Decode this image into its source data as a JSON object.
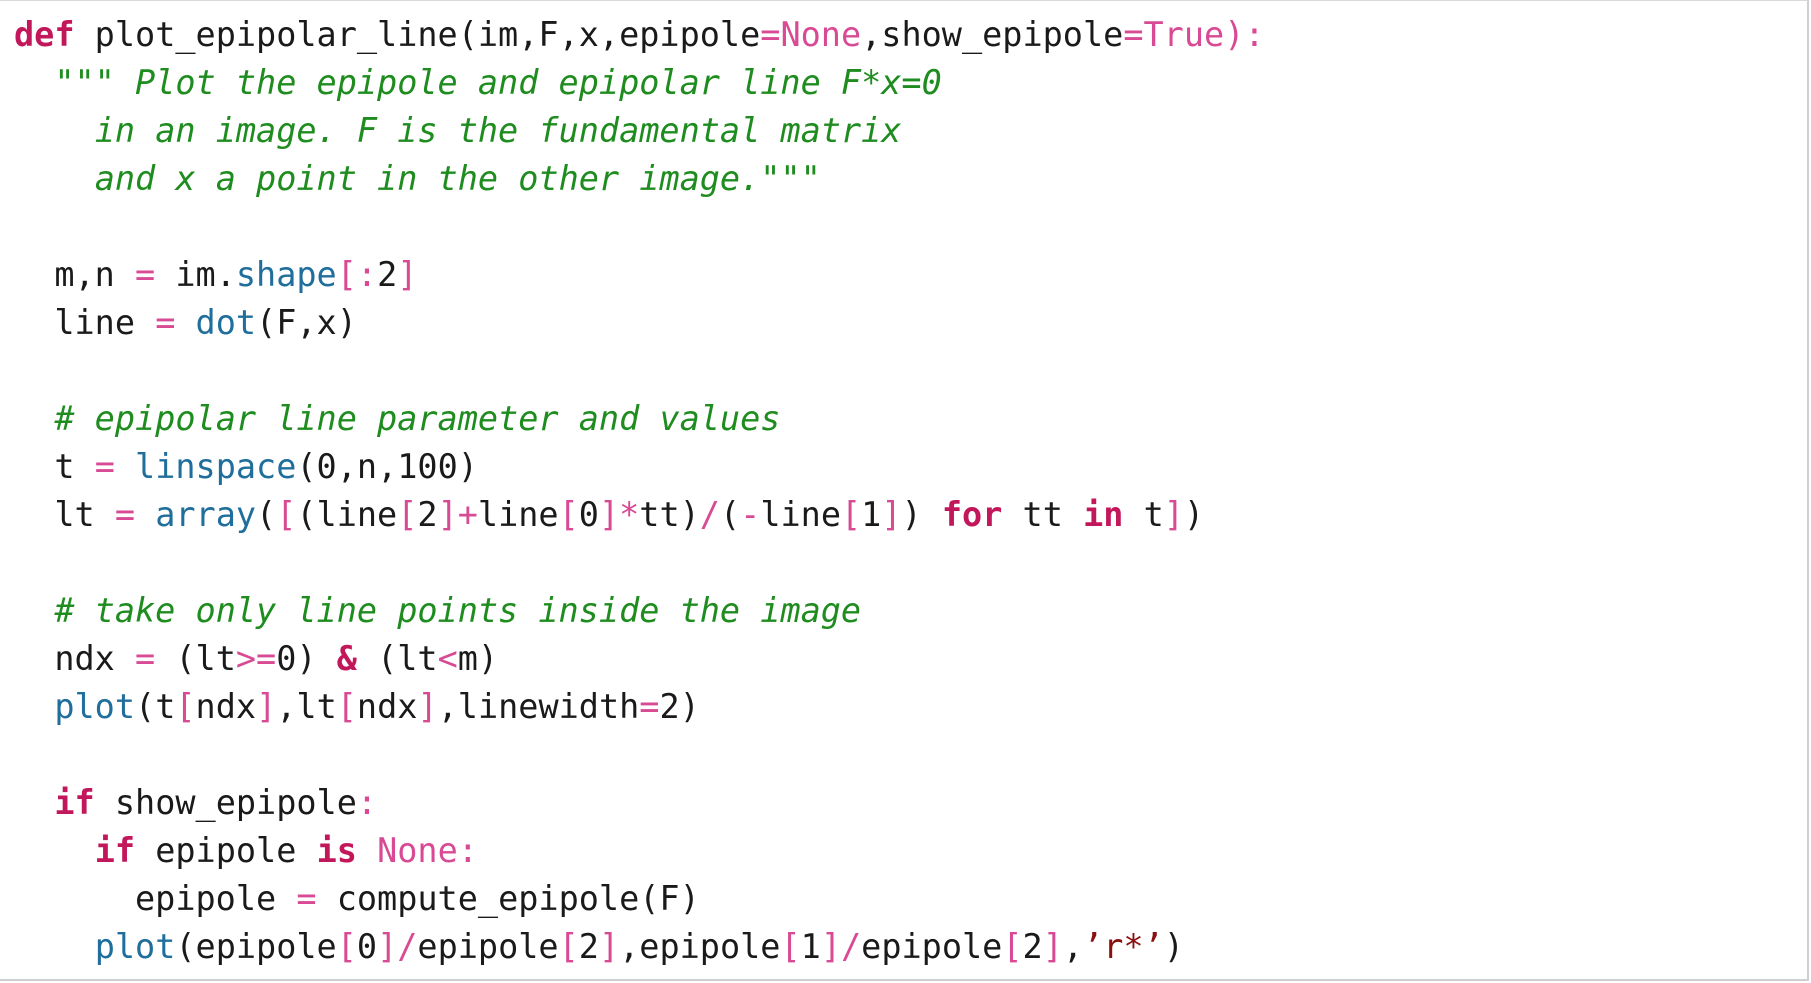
{
  "code": {
    "lines": [
      [
        {
          "t": "def",
          "c": "k"
        },
        {
          "t": " plot_epipolar_line(im,F,x,epipole",
          "c": "t"
        },
        {
          "t": "=",
          "c": "o"
        },
        {
          "t": "None",
          "c": "b"
        },
        {
          "t": ",show_epipole",
          "c": "t"
        },
        {
          "t": "=",
          "c": "o"
        },
        {
          "t": "True",
          "c": "b"
        },
        {
          "t": "):",
          "c": "o"
        }
      ],
      [
        {
          "t": "  ",
          "c": "t"
        },
        {
          "t": "\"\"\" Plot the epipole and epipolar line F*x=0",
          "c": "c"
        }
      ],
      [
        {
          "t": "    ",
          "c": "t"
        },
        {
          "t": "in an image. F is the fundamental matrix",
          "c": "c"
        }
      ],
      [
        {
          "t": "    ",
          "c": "t"
        },
        {
          "t": "and x a point in the other image.\"\"\"",
          "c": "c"
        }
      ],
      [],
      [
        {
          "t": "  m,n ",
          "c": "t"
        },
        {
          "t": "=",
          "c": "o"
        },
        {
          "t": " im.",
          "c": "t"
        },
        {
          "t": "shape",
          "c": "f"
        },
        {
          "t": "[:",
          "c": "o"
        },
        {
          "t": "2",
          "c": "t"
        },
        {
          "t": "]",
          "c": "o"
        }
      ],
      [
        {
          "t": "  line ",
          "c": "t"
        },
        {
          "t": "=",
          "c": "o"
        },
        {
          "t": " ",
          "c": "t"
        },
        {
          "t": "dot",
          "c": "f"
        },
        {
          "t": "(F,x)",
          "c": "t"
        }
      ],
      [],
      [
        {
          "t": "  ",
          "c": "t"
        },
        {
          "t": "# epipolar line parameter and values",
          "c": "c"
        }
      ],
      [
        {
          "t": "  t ",
          "c": "t"
        },
        {
          "t": "=",
          "c": "o"
        },
        {
          "t": " ",
          "c": "t"
        },
        {
          "t": "linspace",
          "c": "f"
        },
        {
          "t": "(0,n,100)",
          "c": "t"
        }
      ],
      [
        {
          "t": "  lt ",
          "c": "t"
        },
        {
          "t": "=",
          "c": "o"
        },
        {
          "t": " ",
          "c": "t"
        },
        {
          "t": "array",
          "c": "f"
        },
        {
          "t": "(",
          "c": "t"
        },
        {
          "t": "[",
          "c": "o"
        },
        {
          "t": "(line",
          "c": "t"
        },
        {
          "t": "[",
          "c": "o"
        },
        {
          "t": "2",
          "c": "t"
        },
        {
          "t": "]+",
          "c": "o"
        },
        {
          "t": "line",
          "c": "t"
        },
        {
          "t": "[",
          "c": "o"
        },
        {
          "t": "0",
          "c": "t"
        },
        {
          "t": "]*",
          "c": "o"
        },
        {
          "t": "tt)",
          "c": "t"
        },
        {
          "t": "/",
          "c": "o"
        },
        {
          "t": "(",
          "c": "t"
        },
        {
          "t": "-",
          "c": "o"
        },
        {
          "t": "line",
          "c": "t"
        },
        {
          "t": "[",
          "c": "o"
        },
        {
          "t": "1",
          "c": "t"
        },
        {
          "t": "]",
          "c": "o"
        },
        {
          "t": ") ",
          "c": "t"
        },
        {
          "t": "for",
          "c": "k"
        },
        {
          "t": " tt ",
          "c": "t"
        },
        {
          "t": "in",
          "c": "k"
        },
        {
          "t": " t",
          "c": "t"
        },
        {
          "t": "]",
          "c": "o"
        },
        {
          "t": ")",
          "c": "t"
        }
      ],
      [],
      [
        {
          "t": "  ",
          "c": "t"
        },
        {
          "t": "# take only line points inside the image",
          "c": "c"
        }
      ],
      [
        {
          "t": "  ndx ",
          "c": "t"
        },
        {
          "t": "=",
          "c": "o"
        },
        {
          "t": " (lt",
          "c": "t"
        },
        {
          "t": ">=",
          "c": "o"
        },
        {
          "t": "0) ",
          "c": "t"
        },
        {
          "t": "&",
          "c": "k"
        },
        {
          "t": " (lt",
          "c": "t"
        },
        {
          "t": "<",
          "c": "o"
        },
        {
          "t": "m)",
          "c": "t"
        }
      ],
      [
        {
          "t": "  ",
          "c": "t"
        },
        {
          "t": "plot",
          "c": "f"
        },
        {
          "t": "(t",
          "c": "t"
        },
        {
          "t": "[",
          "c": "o"
        },
        {
          "t": "ndx",
          "c": "t"
        },
        {
          "t": "]",
          "c": "o"
        },
        {
          "t": ",lt",
          "c": "t"
        },
        {
          "t": "[",
          "c": "o"
        },
        {
          "t": "ndx",
          "c": "t"
        },
        {
          "t": "]",
          "c": "o"
        },
        {
          "t": ",linewidth",
          "c": "t"
        },
        {
          "t": "=",
          "c": "o"
        },
        {
          "t": "2)",
          "c": "t"
        }
      ],
      [],
      [
        {
          "t": "  ",
          "c": "t"
        },
        {
          "t": "if",
          "c": "k"
        },
        {
          "t": " show_epipole",
          "c": "t"
        },
        {
          "t": ":",
          "c": "o"
        }
      ],
      [
        {
          "t": "    ",
          "c": "t"
        },
        {
          "t": "if",
          "c": "k"
        },
        {
          "t": " epipole ",
          "c": "t"
        },
        {
          "t": "is",
          "c": "k"
        },
        {
          "t": " ",
          "c": "t"
        },
        {
          "t": "None",
          "c": "b"
        },
        {
          "t": ":",
          "c": "o"
        }
      ],
      [
        {
          "t": "      epipole ",
          "c": "t"
        },
        {
          "t": "=",
          "c": "o"
        },
        {
          "t": " compute_epipole(F)",
          "c": "t"
        }
      ],
      [
        {
          "t": "    ",
          "c": "t"
        },
        {
          "t": "plot",
          "c": "f"
        },
        {
          "t": "(epipole",
          "c": "t"
        },
        {
          "t": "[",
          "c": "o"
        },
        {
          "t": "0",
          "c": "t"
        },
        {
          "t": "]/",
          "c": "o"
        },
        {
          "t": "epipole",
          "c": "t"
        },
        {
          "t": "[",
          "c": "o"
        },
        {
          "t": "2",
          "c": "t"
        },
        {
          "t": "]",
          "c": "o"
        },
        {
          "t": ",epipole",
          "c": "t"
        },
        {
          "t": "[",
          "c": "o"
        },
        {
          "t": "1",
          "c": "t"
        },
        {
          "t": "]/",
          "c": "o"
        },
        {
          "t": "epipole",
          "c": "t"
        },
        {
          "t": "[",
          "c": "o"
        },
        {
          "t": "2",
          "c": "t"
        },
        {
          "t": "]",
          "c": "o"
        },
        {
          "t": ",",
          "c": "t"
        },
        {
          "t": "’r*’",
          "c": "s"
        },
        {
          "t": ")",
          "c": "t"
        }
      ]
    ]
  }
}
